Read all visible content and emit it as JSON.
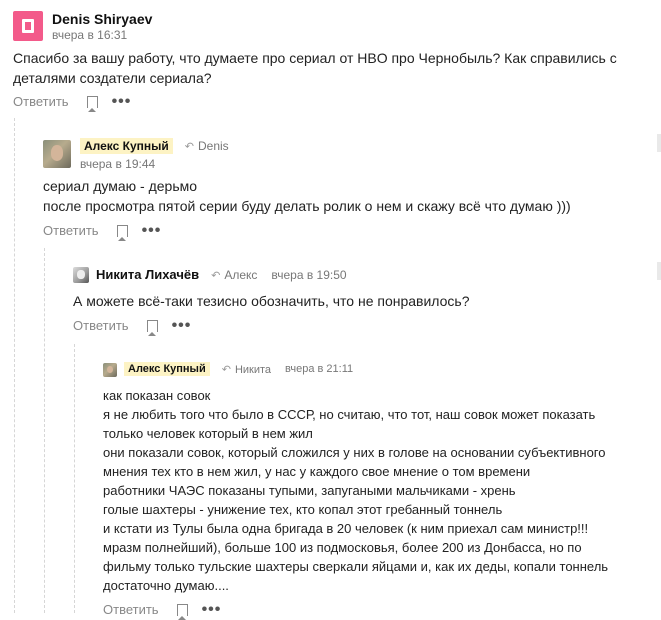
{
  "comments": [
    {
      "author": "Denis Shiryaev",
      "time": "вчера в 16:31",
      "reply_to": "",
      "lines": [
        "Спасибо за вашу работу, что думаете про сериал от HBO про Чернобыль? Как справились с",
        "деталями создатели сериала?"
      ],
      "reply_label": "Ответить"
    },
    {
      "author": "Алекс Купный",
      "time": "вчера в 19:44",
      "reply_to": "Denis",
      "lines": [
        "сериал думаю - дерьмо",
        "после просмотра пятой серии буду делать ролик о нем и скажу всё что думаю )))"
      ],
      "reply_label": "Ответить"
    },
    {
      "author": "Никита Лихачёв",
      "time": "вчера в 19:50",
      "reply_to": "Алекс",
      "lines": [
        "А можете всё-таки тезисно обозначить, что не понравилось?"
      ],
      "reply_label": "Ответить"
    },
    {
      "author": "Алекс Купный",
      "time": "вчера в 21:11",
      "reply_to": "Никита",
      "lines": [
        "как показан совок",
        "я не любить того что было в СССР, но считаю, что тот, наш совок может показать",
        "только человек который в нем жил",
        "они показали совок, который сложился у них в голове на основании субъективного",
        "мнения тех кто в нем жил, у нас у каждого свое мнение о том времени",
        "работники ЧАЭС показаны тупыми, запугаными мальчиками - хрень",
        "голые шахтеры - унижение тех, кто копал этот гребанный тоннель",
        "и кстати из Тулы была одна бригада в 20 человек (к ним приехал сам министр!!!",
        "мразм полнейший), больше 100 из подмосковья, более 200 из Донбасса, но по",
        "фильму только тульские шахтеры сверкали яйцами и, как их деды, копали тоннель",
        "достаточно думаю...."
      ],
      "reply_label": "Ответить"
    }
  ],
  "icons": {
    "reply_arrow": "reply-arrow-icon",
    "bookmark": "bookmark-icon",
    "more": "more-icon"
  },
  "colors": {
    "highlight_name_bg": "#fdf3c4",
    "brand_avatar": "#f35a8a",
    "muted_text": "#777777"
  }
}
